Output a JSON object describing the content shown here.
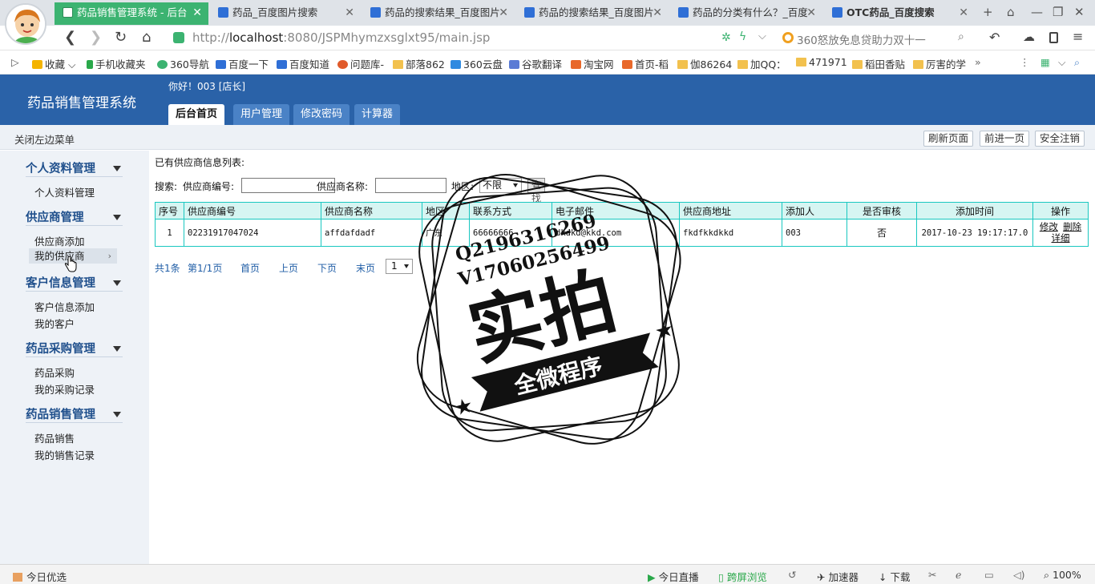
{
  "browser": {
    "tabs": [
      {
        "label": "药品销售管理系统 - 后台",
        "active": true
      },
      {
        "label": "药品_百度图片搜索",
        "active": false
      },
      {
        "label": "药品的搜索结果_百度图片",
        "active": false
      },
      {
        "label": "药品的搜索结果_百度图片",
        "active": false
      },
      {
        "label": "药品的分类有什么？_百度",
        "active": false
      },
      {
        "label": "OTC药品_百度搜索",
        "active": false
      }
    ],
    "url_prefix": "http://",
    "url_host": "localhost",
    "url_rest": ":8080/JSPMhymzxsglxt95/main.jsp",
    "search_hint": "360怒放免息贷助力双十一",
    "bookmarks": [
      "收藏",
      "手机收藏夹",
      "360导航",
      "百度一下",
      "百度知道",
      "问题库-",
      "部落862",
      "360云盘",
      "谷歌翻译",
      "淘宝网",
      "首页-稻",
      "伽86264",
      "加QQ：",
      "471971",
      "稻田香贴",
      "厉害的学"
    ],
    "status": {
      "left": "今日优选",
      "live": "今日直播",
      "cross": "跨屏浏览",
      "speed": "加速器",
      "download": "下载",
      "zoom": "100%"
    }
  },
  "app": {
    "title": "药品销售管理系统",
    "greeting": "你好！003 [店长]",
    "menu": [
      "后台首页",
      "用户管理",
      "修改密码",
      "计算器"
    ],
    "close_menu": "关闭左边菜单",
    "top_buttons": [
      "刷新页面",
      "前进一页",
      "安全注销"
    ]
  },
  "sidebar": {
    "groups": [
      {
        "title": "个人资料管理",
        "items": [
          "个人资料管理"
        ]
      },
      {
        "title": "供应商管理",
        "items": [
          "供应商添加",
          "我的供应商"
        ]
      },
      {
        "title": "客户信息管理",
        "items": [
          "客户信息添加",
          "我的客户"
        ]
      },
      {
        "title": "药品采购管理",
        "items": [
          "药品采购",
          "我的采购记录"
        ]
      },
      {
        "title": "药品销售管理",
        "items": [
          "药品销售",
          "我的销售记录"
        ]
      }
    ]
  },
  "main": {
    "list_title": "已有供应商信息列表:",
    "search_label": "搜索:",
    "code_label": "供应商编号:",
    "name_label": "供应商名称:",
    "region_label": "地区:",
    "region_value": "不限",
    "find_button": "查找",
    "columns": [
      "序号",
      "供应商编号",
      "供应商名称",
      "地区",
      "联系方式",
      "电子邮件",
      "供应商地址",
      "添加人",
      "是否审核",
      "添加时间",
      "操作"
    ],
    "rows": [
      {
        "no": "1",
        "code": "02231917047024",
        "name": "affdafdadf",
        "region": "广东",
        "contact": "66666666",
        "email": "dkdkd@kkd.com",
        "address": "fkdfkkdkkd",
        "adder": "003",
        "audit": "否",
        "time": "2017-10-23 19:17:17.0"
      }
    ],
    "ops": [
      "修改",
      "删除",
      "详细"
    ],
    "pager": {
      "total": "共1条",
      "page": "第1/1页",
      "first": "首页",
      "prev": "上页",
      "next": "下页",
      "last": "末页",
      "select": "1"
    }
  },
  "watermark": {
    "line1": "Q2196316269",
    "line2": "V17060256499",
    "big": "实拍",
    "banner": "全微程序"
  }
}
